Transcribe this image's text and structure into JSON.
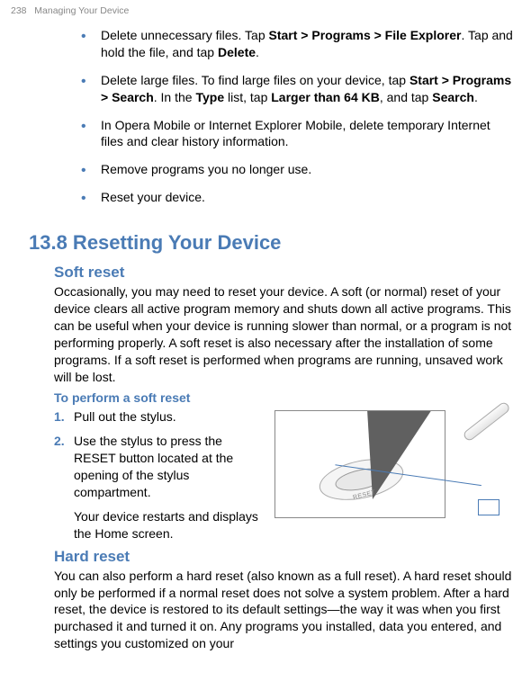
{
  "header": {
    "page_number": "238",
    "chapter_title": "Managing Your Device"
  },
  "bullets": {
    "b1_pre": "Delete unnecessary files. Tap ",
    "b1_bold1": "Start > Programs > File Explorer",
    "b1_mid": ". Tap and hold the file, and tap ",
    "b1_bold2": "Delete",
    "b1_end": ".",
    "b2_pre": "Delete large files. To find large files on your device, tap ",
    "b2_bold1": "Start > Programs > Search",
    "b2_mid1": ". In the ",
    "b2_bold2": "Type",
    "b2_mid2": " list, tap ",
    "b2_bold3": "Larger than 64 KB",
    "b2_mid3": ", and tap ",
    "b2_bold4": "Search",
    "b2_end": ".",
    "b3": "In Opera Mobile or Internet Explorer Mobile, delete temporary Internet files and clear history information.",
    "b4": "Remove programs you no longer use.",
    "b5": "Reset your device."
  },
  "section": {
    "heading": "13.8  Resetting Your Device"
  },
  "soft_reset": {
    "heading": "Soft reset",
    "body": "Occasionally, you may need to reset your device. A soft (or normal) reset of your device clears all active program memory and shuts down all active programs. This can be useful when your device is running slower than normal, or a program is not performing properly. A soft reset is also necessary after the installation of some programs. If a soft reset is performed when programs are running, unsaved work will be lost.",
    "procedure_heading": "To perform a soft reset",
    "step1_num": "1.",
    "step1_text": "Pull out the stylus.",
    "step2_num": "2.",
    "step2_text": "Use the stylus to press the RESET button located at the opening of the stylus compartment.",
    "step_note": "Your device restarts and displays the Home screen."
  },
  "image": {
    "reset_label": "RESET"
  },
  "hard_reset": {
    "heading": "Hard reset",
    "body": "You can also perform a hard reset (also known as a full reset). A hard reset should only be performed if a normal reset does not solve a system problem. After a hard reset, the device is restored to its default settings—the way it was when you first purchased it and turned it on. Any programs you installed, data you entered, and settings you customized on your"
  }
}
